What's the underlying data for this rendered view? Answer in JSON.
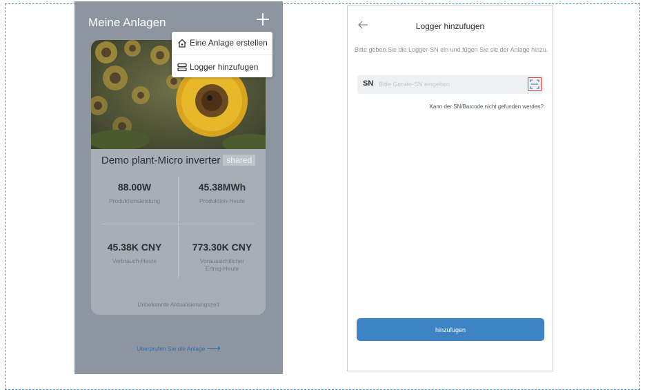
{
  "left_screen": {
    "title": "Meine Anlagen",
    "add_icon": "plus-icon",
    "menu": {
      "items": [
        {
          "label": "Eine Anlage erstellen",
          "icon": "house-add-icon"
        },
        {
          "label": "Logger hinzufugen",
          "icon": "logger-device-icon"
        }
      ]
    },
    "plant": {
      "name": "Demo plant-Micro inverter",
      "badge": "shared",
      "stats": [
        {
          "value": "88.00W",
          "label": "Produktionsleistung"
        },
        {
          "value": "45.38MWh",
          "label": "Produktion-Heute"
        },
        {
          "value": "45.38K CNY",
          "label": "Verbrauch-Heute"
        },
        {
          "value": "773.30K CNY",
          "label": "Voraussichtlicher Ertrag-Heute"
        }
      ],
      "update_status": "Unbekannte Aktualisierungszeit"
    },
    "check_link": "Uberprufen Sie die Anlage",
    "check_link_arrow": "⟶"
  },
  "right_screen": {
    "title": "Logger hinzufugen",
    "back_icon": "back-arrow-icon",
    "instruction": "Bitte geben Sie die Logger-SN ein und fügen Sie sie der Anlage hinzu.",
    "sn_label": "SN",
    "sn_placeholder": "Bitte Gerate-SN eingeben",
    "sn_value": "",
    "scan_icon": "scan-icon",
    "help_link": "Kann der SN/Barcode nicht gefunden werden?",
    "submit_label": "hinzufugen"
  },
  "colors": {
    "accent_blue": "#3e84c4",
    "overlay_gray": "#8d96a0",
    "highlight_red": "#e0433a",
    "dashed_border": "#3f8fc9"
  }
}
